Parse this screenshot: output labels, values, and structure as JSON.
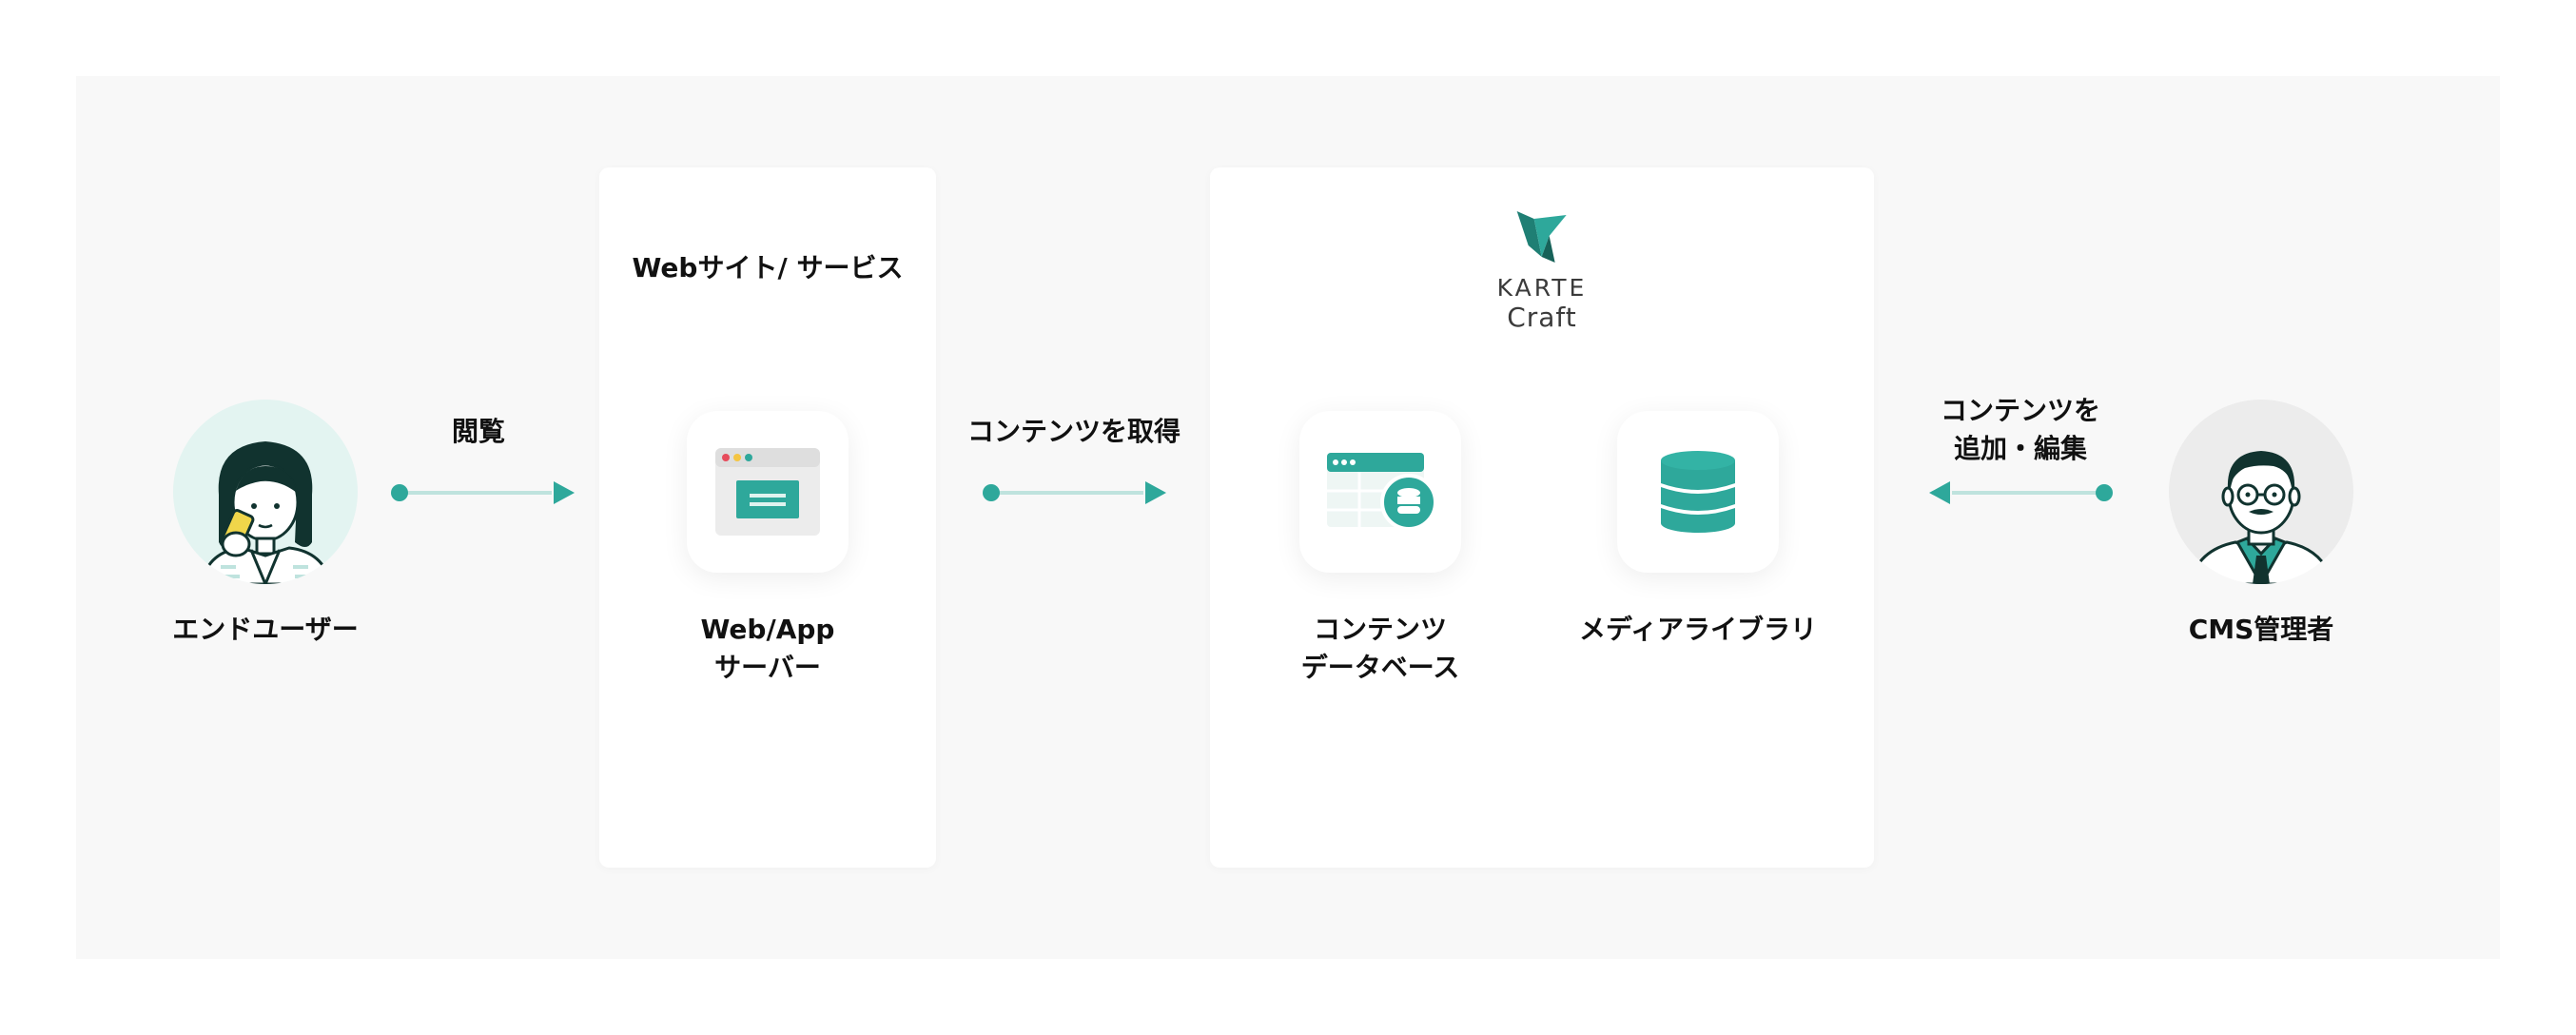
{
  "end_user": {
    "label": "エンドユーザー"
  },
  "arrow_view": {
    "label": "閲覧"
  },
  "web_card": {
    "title": "Webサイト/ サービス",
    "server_label_line1": "Web/App",
    "server_label_line2": "サーバー"
  },
  "arrow_fetch": {
    "label": "コンテンツを取得"
  },
  "craft_card": {
    "logo_word": "KARTE",
    "logo_sub": "Craft",
    "content_db_line1": "コンテンツ",
    "content_db_line2": "データベース",
    "media_library": "メディアライブラリ"
  },
  "arrow_edit": {
    "label_line1": "コンテンツを",
    "label_line2": "追加・編集"
  },
  "cms_admin": {
    "label": "CMS管理者"
  },
  "colors": {
    "accent": "#2ea89b",
    "arrow_line": "#bfe3de",
    "panel": "#f8f8f8"
  },
  "icons": [
    "end-user-avatar",
    "browser-window-icon",
    "karte-logo-icon",
    "content-database-icon",
    "media-library-icon",
    "cms-admin-avatar"
  ]
}
